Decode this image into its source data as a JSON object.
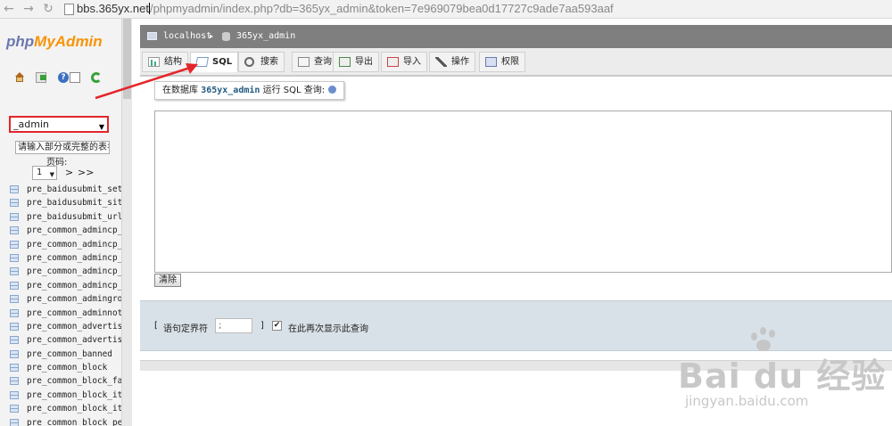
{
  "browser": {
    "url_host": "bbs.365yx.net",
    "url_path": "/phpmyadmin/index.php?db=365yx_admin&token=7e969079bea0d17727c9ade7aa593aaf"
  },
  "nav": {
    "logo_php": "php",
    "logo_my": "My",
    "logo_admin": "Admin",
    "db_select_value": "_admin",
    "filter_placeholder": "请输入部分或完整的表名",
    "page_label": "页码:",
    "page_value": "1",
    "page_next": ">",
    "page_last": ">>",
    "tables": [
      "pre_baidusubmit_sett",
      "pre_baidusubmit_siter",
      "pre_baidusubmit_urlst",
      "pre_common_admincp_cr",
      "pre_common_admincp_gr",
      "pre_common_admincp_me",
      "pre_common_admincp_pe",
      "pre_common_admincp_se",
      "pre_common_admingroup",
      "pre_common_adminnote",
      "pre_common_advertisem",
      "pre_common_advertisem",
      "pre_common_banned",
      "pre_common_block",
      "pre_common_block_favo",
      "pre_common_block_item",
      "pre_common_block_item",
      "pre_common_block_perm",
      "pre_common_block_pic"
    ]
  },
  "breadcrumb": {
    "server": "localhost",
    "separator": "▸",
    "database": "365yx_admin"
  },
  "tabs": {
    "structure": "结构",
    "sql": "SQL",
    "search": "搜索",
    "query": "查询",
    "export": "导出",
    "import": "导入",
    "operations": "操作",
    "privileges": "权限"
  },
  "sql": {
    "legend_prefix": "在数据库",
    "legend_db": "365yx_admin",
    "legend_suffix": "运行 SQL 查询:",
    "clear_button": "清除"
  },
  "options": {
    "delim_open": "[",
    "delim_label": "语句定界符",
    "delimiter_value": ";",
    "delim_close": "]",
    "retain_checked": "✔",
    "retain_label": "在此再次显示此查询"
  },
  "watermark": {
    "brand": "Bai du 经验",
    "url": "jingyan.baidu.com"
  },
  "colors": {
    "annotation": "#e3262b",
    "breadcrumb_bg": "#7f7f7f",
    "options_bg": "#d9e1e8"
  }
}
